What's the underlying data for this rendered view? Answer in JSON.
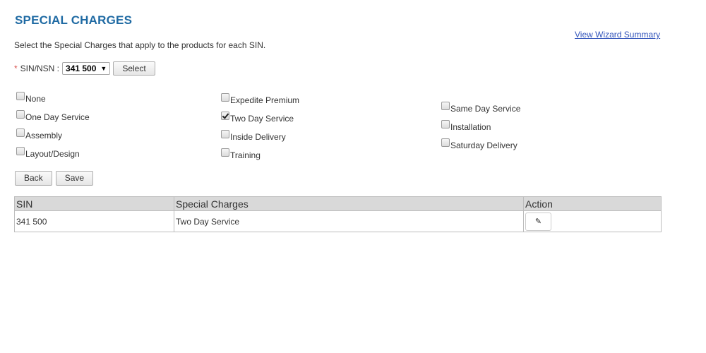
{
  "page": {
    "title": "SPECIAL CHARGES",
    "wizard_link": "View Wizard Summary",
    "instructions": "Select the Special Charges that apply to the products for each SIN."
  },
  "sin_selector": {
    "required_mark": "*",
    "label": "SIN/NSN :",
    "selected_value": "341 500",
    "arrow": "▼",
    "select_button": "Select"
  },
  "charges": {
    "none": {
      "label": "None",
      "checked": false
    },
    "one_day": {
      "label": "One Day Service",
      "checked": false
    },
    "assembly": {
      "label": "Assembly",
      "checked": false
    },
    "layout": {
      "label": "Layout/Design",
      "checked": false
    },
    "expedite": {
      "label": "Expedite Premium",
      "checked": false
    },
    "two_day": {
      "label": "Two Day Service",
      "checked": true
    },
    "inside_delivery": {
      "label": "Inside Delivery",
      "checked": false
    },
    "training": {
      "label": "Training",
      "checked": false
    },
    "same_day": {
      "label": "Same Day Service",
      "checked": false
    },
    "installation": {
      "label": "Installation",
      "checked": false
    },
    "saturday": {
      "label": "Saturday Delivery",
      "checked": false
    }
  },
  "buttons": {
    "back": "Back",
    "save": "Save"
  },
  "table": {
    "headers": {
      "sin": "SIN",
      "charges": "Special Charges",
      "action": "Action"
    },
    "rows": [
      {
        "sin": "341 500",
        "charges": "Two Day Service",
        "edit_icon": "pencil-icon",
        "edit_glyph": "✎"
      }
    ]
  }
}
